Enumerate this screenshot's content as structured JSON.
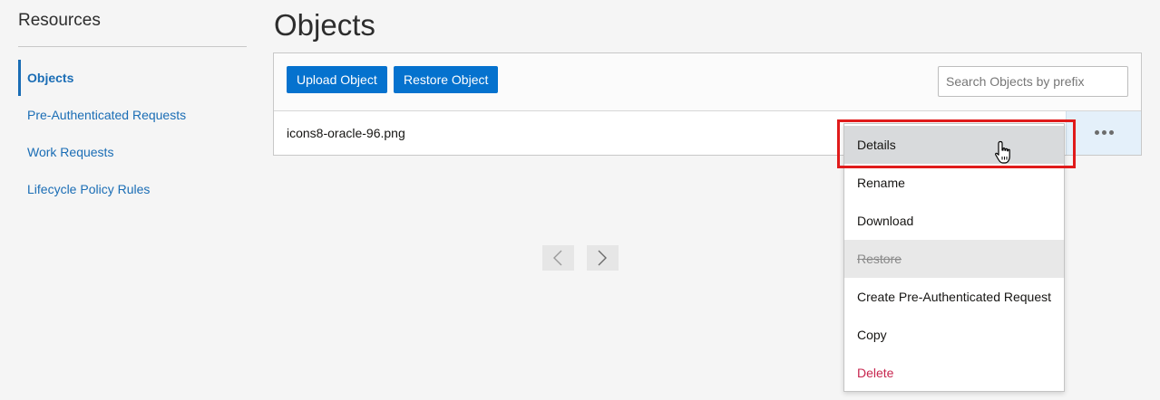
{
  "sidebar": {
    "title": "Resources",
    "items": [
      {
        "label": "Objects",
        "active": true
      },
      {
        "label": "Pre-Authenticated Requests"
      },
      {
        "label": "Work Requests"
      },
      {
        "label": "Lifecycle Policy Rules"
      }
    ]
  },
  "main": {
    "title": "Objects",
    "toolbar": {
      "upload_label": "Upload Object",
      "restore_label": "Restore Object",
      "search_placeholder": "Search Objects by prefix"
    },
    "rows": [
      {
        "name": "icons8-oracle-96.png"
      }
    ]
  },
  "menu": {
    "items": [
      {
        "label": "Details",
        "state": "hover"
      },
      {
        "label": "Rename"
      },
      {
        "label": "Download"
      },
      {
        "label": "Restore",
        "state": "disabled"
      },
      {
        "label": "Create Pre-Authenticated Request"
      },
      {
        "label": "Copy"
      },
      {
        "label": "Delete",
        "state": "danger"
      }
    ]
  },
  "icons": {
    "actions": "ellipsis-icon",
    "prev": "chevron-left-icon",
    "next": "chevron-right-icon",
    "cursor": "hand-pointer-icon"
  },
  "colors": {
    "primary": "#0572ce",
    "link": "#1a6db5",
    "danger": "#c7254e",
    "highlight": "#e01b1b"
  }
}
